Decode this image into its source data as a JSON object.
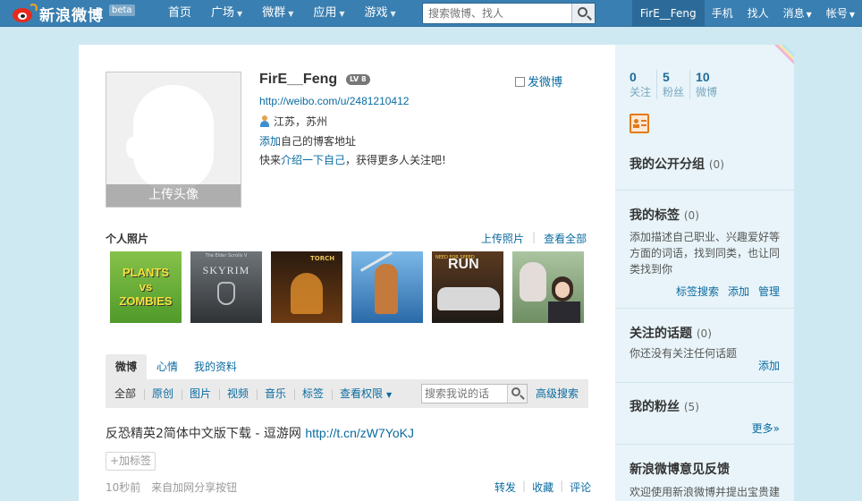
{
  "topbar": {
    "logo_text": "新浪微博",
    "beta": "beta",
    "nav": [
      {
        "label": "首页",
        "caret": false
      },
      {
        "label": "广场",
        "caret": true
      },
      {
        "label": "微群",
        "caret": true
      },
      {
        "label": "应用",
        "caret": true
      },
      {
        "label": "游戏",
        "caret": true
      }
    ],
    "search_placeholder": "搜索微博、找人",
    "user": [
      "FirE__Feng",
      "手机",
      "找人",
      "消息",
      "帐号"
    ]
  },
  "profile": {
    "name": "FirE__Feng",
    "level": "LV 8",
    "post_weibo": "发微博",
    "url": "http://weibo.com/u/2481210412",
    "location": "江苏，苏州",
    "blog_link": "添加",
    "blog_text": "自己的博客地址",
    "intro_prefix": "快来",
    "intro_link": "介绍一下自己",
    "intro_suffix": "，获得更多人关注吧!",
    "upload_avatar": "上传头像"
  },
  "photos": {
    "title": "个人照片",
    "upload": "上传照片",
    "view_all": "查看全部",
    "thumb_texts": {
      "t1": "PLANTS vs ZOMBIES",
      "t2": "SKYRIM",
      "t2_small": "The Elder Scrolls V",
      "t3": "TORCH",
      "t5": "RUN",
      "t5_small": "NEED FOR SPEED"
    }
  },
  "tabs": [
    "微博",
    "心情",
    "我的资料"
  ],
  "filters": [
    "全部",
    "原创",
    "图片",
    "视频",
    "音乐",
    "标签",
    "查看权限"
  ],
  "filter_search_placeholder": "搜索我说的话",
  "advanced_search": "高级搜索",
  "post": {
    "text": "反恐精英2简体中文版下载 - 逗游网 ",
    "link": "http://t.cn/zW7YoKJ",
    "add_tag": "+加标签",
    "time": "10秒前",
    "source": "来自加网分享按钮",
    "actions": [
      "转发",
      "收藏",
      "评论"
    ]
  },
  "sidebar": {
    "stats": [
      {
        "n": "0",
        "l": "关注"
      },
      {
        "n": "5",
        "l": "粉丝"
      },
      {
        "n": "10",
        "l": "微博"
      }
    ],
    "groups": {
      "title": "我的公开分组",
      "count": "(0)"
    },
    "tags": {
      "title": "我的标签",
      "count": "(0)",
      "desc": "添加描述自己职业、兴趣爱好等方面的词语，找到同类，也让同类找到你",
      "links": [
        "标签搜索",
        "添加",
        "管理"
      ]
    },
    "topics": {
      "title": "关注的话题",
      "count": "(0)",
      "desc": "你还没有关注任何话题",
      "link": "添加"
    },
    "fans": {
      "title": "我的粉丝",
      "count": "(5)",
      "more": "更多»"
    },
    "feedback": {
      "title": "新浪微博意见反馈",
      "desc": "欢迎使用新浪微博并提出宝贵建"
    }
  },
  "colors": {
    "topbar": "#3a7fb1",
    "link": "#0a6ba0",
    "background": "#cfe9f3",
    "sidebar": "#e8f4f9"
  }
}
